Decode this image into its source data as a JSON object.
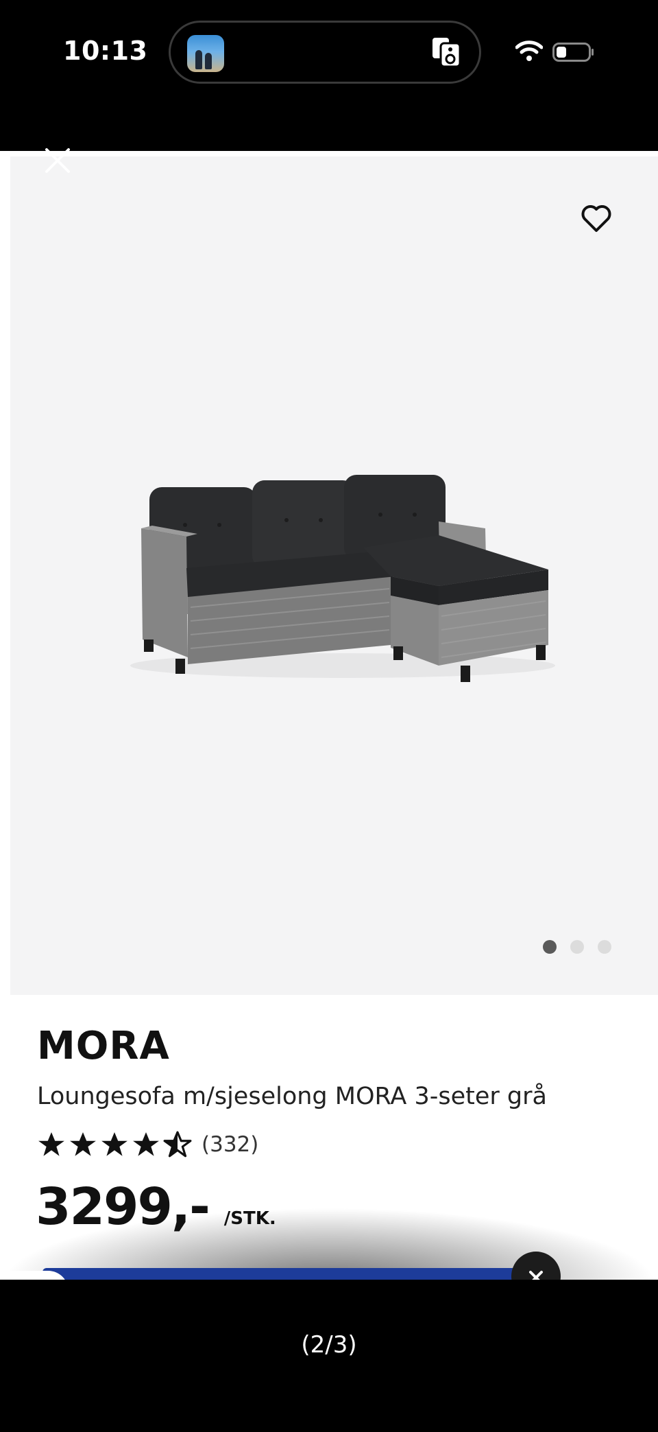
{
  "status_bar": {
    "time": "10:13",
    "app_icon": "photo-app-icon",
    "icons": [
      "speaker-icon",
      "wifi-icon",
      "battery-icon"
    ]
  },
  "viewer": {
    "close_icon": "close-icon",
    "favorite_icon": "heart-icon",
    "image_subject": "sofa-product-image",
    "carousel": {
      "count": 3,
      "active_index": 0
    }
  },
  "product": {
    "brand": "MORA",
    "name": "Loungesofa m/sjeselong MORA 3-seter grå",
    "rating_stars": 4.5,
    "review_count": "(332)",
    "price": "3299,-",
    "unit": "/STK."
  },
  "promo": {
    "color": "#1d3c9a",
    "close_icon": "close-icon"
  },
  "footer": {
    "page_counter": "(2/3)"
  }
}
